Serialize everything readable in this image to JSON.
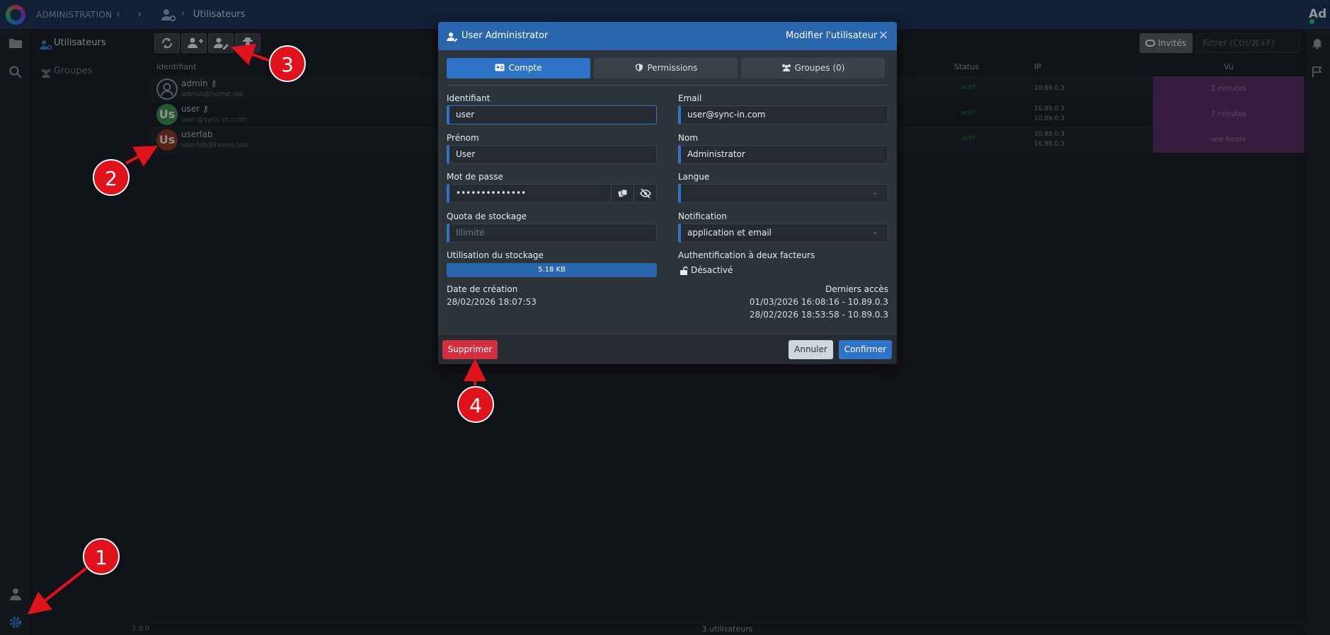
{
  "header": {
    "section": "ADMINISTRATION",
    "breadcrumb_title": "Utilisateurs",
    "avatar_initials": "Ad"
  },
  "sidebar": {
    "items": [
      {
        "label": "Utilisateurs",
        "icon": "users-cog-icon",
        "active": true
      },
      {
        "label": "Groupes",
        "icon": "users-group-icon",
        "active": false
      }
    ],
    "version": "2.0.0"
  },
  "toolbar": {
    "buttons": [
      "refresh-icon",
      "add-user-icon",
      "edit-user-icon",
      "user-secret-icon"
    ],
    "invites_label": "Invités",
    "filter_placeholder": "Filtrer (Ctrl/⌘+F)"
  },
  "table": {
    "columns": [
      "Identifiant",
      "Status",
      "IP",
      "Vu"
    ],
    "rows": [
      {
        "name": "admin",
        "email": "admin@home.lab",
        "status": "actif",
        "ips": [
          "10.89.0.3"
        ],
        "seen": "2 minutes",
        "avatar": "",
        "key": true
      },
      {
        "name": "user",
        "email": "user@sync-in.com",
        "status": "actif",
        "ips": [
          "10.89.0.3",
          "10.89.0.3"
        ],
        "seen": "7 minutes",
        "avatar": "Us",
        "key": true
      },
      {
        "name": "userlab",
        "email": "userlab@home.lab",
        "status": "actif",
        "ips": [
          "10.89.0.3",
          "10.89.0.3"
        ],
        "seen": "une heure",
        "avatar": "Us",
        "key": false
      }
    ],
    "footer_count": "3 utilisateurs"
  },
  "modal": {
    "title": "User Administrator",
    "subtitle": "Modifier l'utilisateur",
    "tabs": [
      {
        "label": "Compte",
        "icon": "id-card-icon",
        "active": true
      },
      {
        "label": "Permissions",
        "icon": "shield-icon",
        "active": false
      },
      {
        "label": "Groupes (0)",
        "icon": "users-group-icon",
        "active": false
      }
    ],
    "fields": {
      "identifiant_label": "Identifiant",
      "identifiant_value": "user",
      "email_label": "Email",
      "email_value": "user@sync-in.com",
      "prenom_label": "Prénom",
      "prenom_value": "User",
      "nom_label": "Nom",
      "nom_value": "Administrator",
      "password_label": "Mot de passe",
      "password_value": "••••••••••••••",
      "langue_label": "Langue",
      "langue_value": "",
      "quota_label": "Quota de stockage",
      "quota_placeholder": "Illimité",
      "notification_label": "Notification",
      "notification_value": "application et email",
      "usage_label": "Utilisation du stockage",
      "usage_value": "5.18 KB",
      "tfa_label": "Authentification à deux facteurs",
      "tfa_value": "Désactivé",
      "creation_label": "Date de création",
      "creation_value": "28/02/2026 18:07:53",
      "last_access_label": "Derniers accès",
      "last_access_1": "01/03/2026 16:08:16 - 10.89.0.3",
      "last_access_2": "28/02/2026 18:53:58 - 10.89.0.3"
    },
    "buttons": {
      "delete": "Supprimer",
      "cancel": "Annuler",
      "confirm": "Confirmer"
    }
  },
  "annotations": {
    "markers": [
      "1",
      "2",
      "3",
      "4"
    ],
    "color": "#e0131d"
  },
  "colors": {
    "accent": "#2f73c6",
    "header": "#1d3557",
    "danger": "#d32f3f",
    "seen_bg": "#5a2f64"
  }
}
